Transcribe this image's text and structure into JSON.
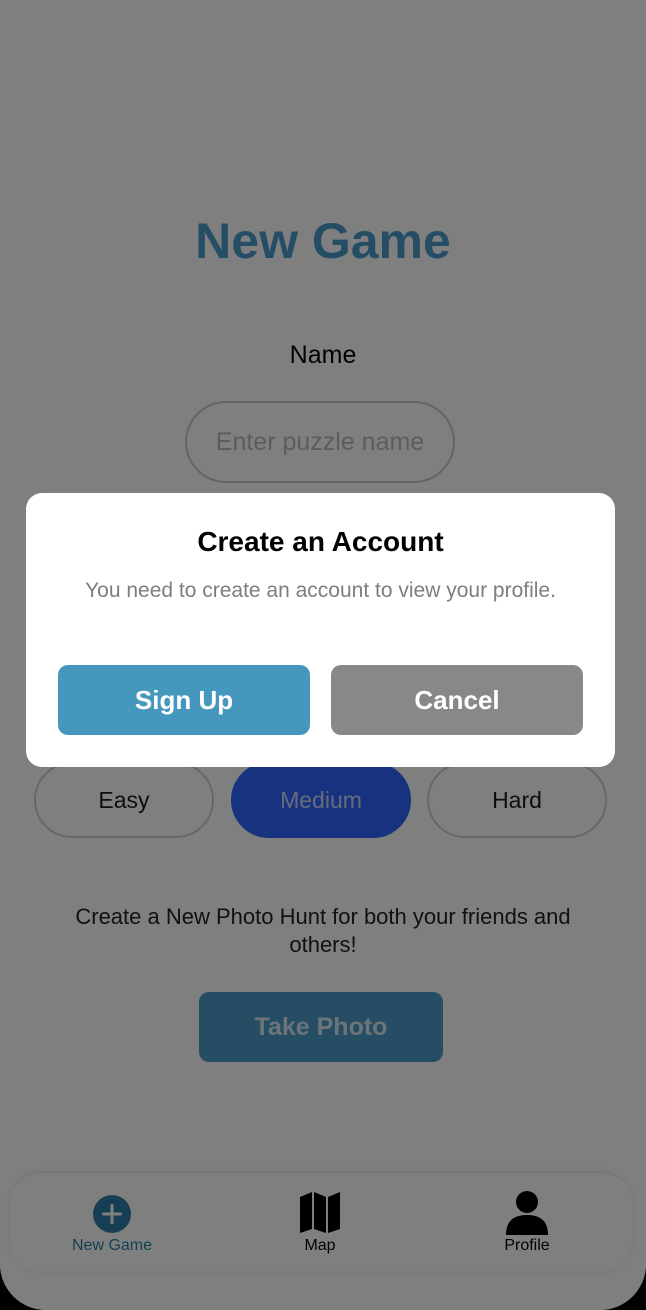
{
  "page": {
    "title": "New Game",
    "accent_color": "#4a9ccb"
  },
  "form": {
    "name_label": "Name",
    "name_placeholder": "Enter puzzle name",
    "name_value": ""
  },
  "difficulty": {
    "options": [
      "Easy",
      "Medium",
      "Hard"
    ],
    "selected": "Medium",
    "selected_color": "#2f66ff"
  },
  "description": "Create a New Photo Hunt for both your friends and others!",
  "take_photo_label": "Take Photo",
  "tabs": [
    {
      "label": "New Game",
      "icon": "plus-circle-icon",
      "active": true
    },
    {
      "label": "Map",
      "icon": "map-icon",
      "active": false
    },
    {
      "label": "Profile",
      "icon": "person-icon",
      "active": false
    }
  ],
  "modal": {
    "title": "Create an Account",
    "message": "You need to create an account to view your profile.",
    "primary_label": "Sign Up",
    "secondary_label": "Cancel",
    "primary_color": "#4597bd",
    "secondary_color": "#888888"
  }
}
